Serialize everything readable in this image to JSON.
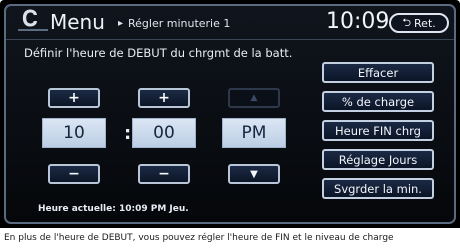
{
  "header": {
    "menu_label": "Menu",
    "breadcrumb_arrow": "▸",
    "breadcrumb": "Régler minuterie 1",
    "clock": "10:09",
    "return_label": "Ret.",
    "return_icon": "return-arrow-icon"
  },
  "instruction": "Définir l'heure de DEBUT du chrgmt de la batt.",
  "time_setter": {
    "plus_label": "+",
    "minus_label": "−",
    "hour": "10",
    "separator": ":",
    "minute": "00",
    "ampm": "PM",
    "up_label": "▲",
    "down_label": "▼"
  },
  "side_buttons": [
    {
      "label": "Effacer"
    },
    {
      "label": "% de charge"
    },
    {
      "label": "Heure FIN chrg"
    },
    {
      "label": "Réglage Jours"
    },
    {
      "label": "Svgrder la min."
    }
  ],
  "current_time": "Heure actuelle: 10:09 PM Jeu.",
  "caption": "En plus de l'heure de DEBUT, vous pouvez régler l'heure de FIN et le niveau de charge"
}
